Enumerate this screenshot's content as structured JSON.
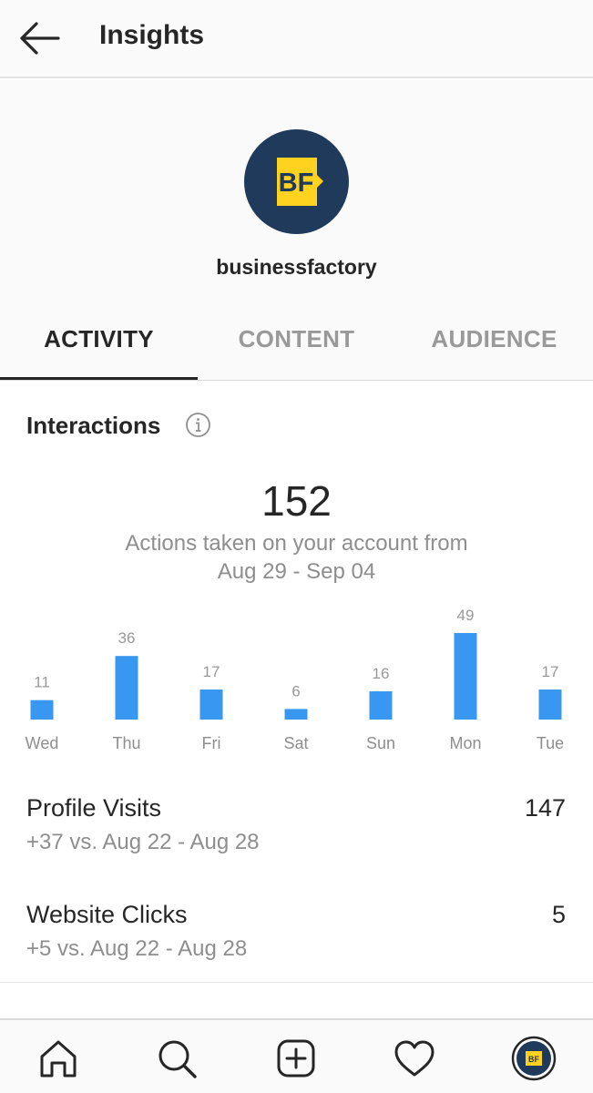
{
  "header": {
    "title": "Insights"
  },
  "profile": {
    "username": "businessfactory",
    "logo_text": "BF"
  },
  "tabs": [
    {
      "label": "ACTIVITY",
      "active": true
    },
    {
      "label": "CONTENT",
      "active": false
    },
    {
      "label": "AUDIENCE",
      "active": false
    }
  ],
  "interactions": {
    "title": "Interactions",
    "total": "152",
    "subtitle_line1": "Actions taken on your account from",
    "subtitle_line2": "Aug 29 - Sep 04"
  },
  "chart_data": {
    "type": "bar",
    "categories": [
      "Wed",
      "Thu",
      "Fri",
      "Sat",
      "Sun",
      "Mon",
      "Tue"
    ],
    "values": [
      11,
      36,
      17,
      6,
      16,
      49,
      17
    ],
    "color": "#3897f0",
    "ylim": [
      0,
      49
    ]
  },
  "stats": [
    {
      "label": "Profile Visits",
      "value": "147",
      "sub": "+37 vs. Aug 22 - Aug 28"
    },
    {
      "label": "Website Clicks",
      "value": "5",
      "sub": "+5 vs. Aug 22 - Aug 28"
    }
  ],
  "nav": {
    "icons": [
      "home-icon",
      "search-icon",
      "new-post-icon",
      "heart-icon",
      "profile-avatar"
    ]
  },
  "colors": {
    "accent": "#3897f0",
    "logo_bg": "#1f3a5a",
    "logo_fg": "#ffd21f",
    "muted_text": "#8e8e8e"
  }
}
